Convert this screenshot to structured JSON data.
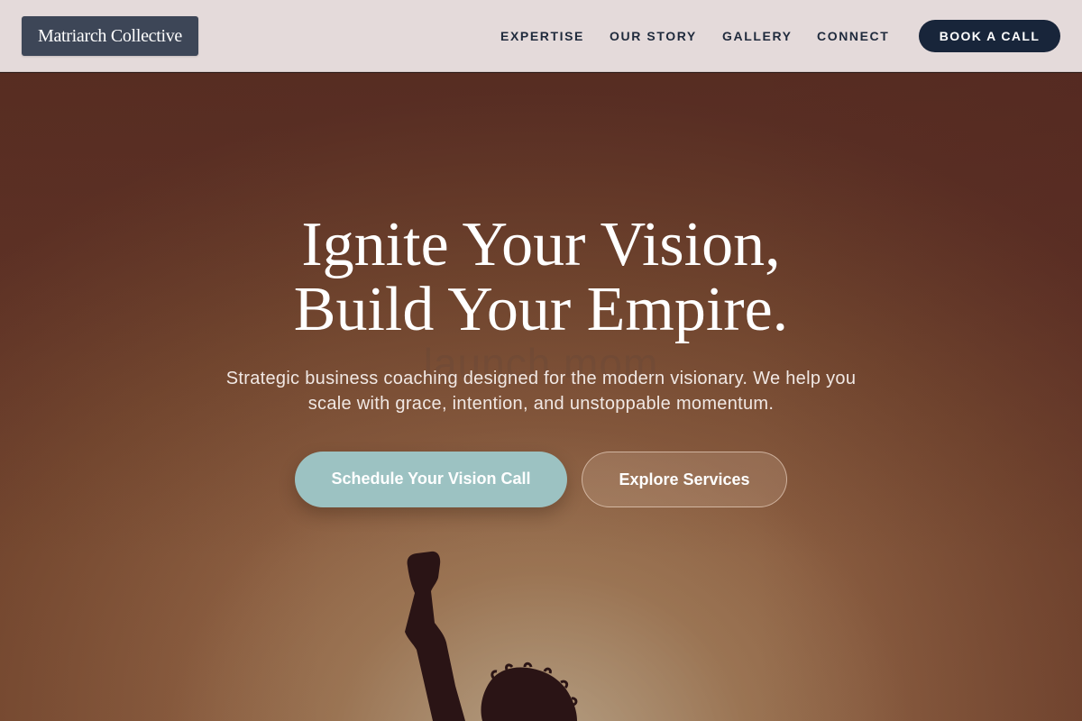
{
  "header": {
    "logo_text": "Matriarch Collective",
    "nav": [
      {
        "label": "EXPERTISE"
      },
      {
        "label": "OUR STORY"
      },
      {
        "label": "GALLERY"
      },
      {
        "label": "CONNECT"
      }
    ],
    "cta_label": "BOOK A CALL"
  },
  "hero": {
    "headline_line1": "Ignite Your Vision,",
    "headline_line2": "Build Your Empire.",
    "watermark_text": "launch mom",
    "subtext": "Strategic business coaching designed for the modern visionary. We help you scale with grace, intention, and unstoppable momentum.",
    "primary_cta": "Schedule Your Vision Call",
    "secondary_cta": "Explore Services",
    "background_image": "silhouette-raised-fist-at-sunset"
  },
  "colors": {
    "header_bg": "#e4dada",
    "logo_bg": "#3d4657",
    "navy": "#18253a",
    "nav_text": "#1f2a3c",
    "teal_cta": "#9cc2c2"
  }
}
